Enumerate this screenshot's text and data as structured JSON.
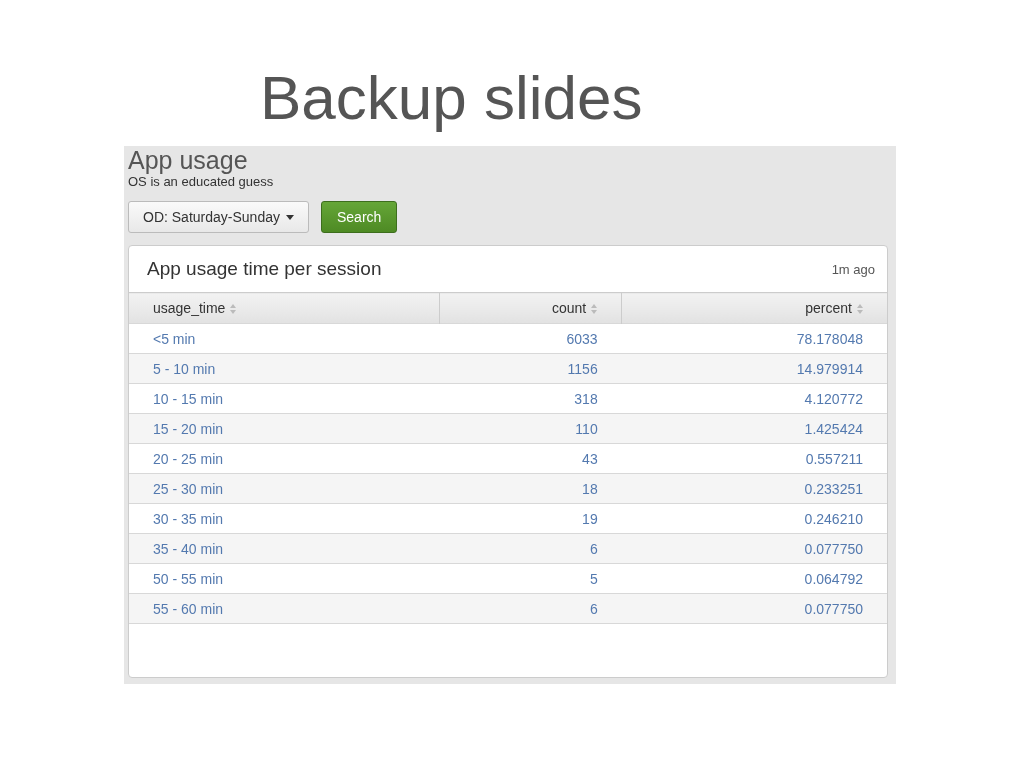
{
  "slide_title": "Backup slides",
  "dashboard": {
    "title": "App usage",
    "description": "OS is an educated guess",
    "dropdown": {
      "value": "OD: Saturday-Sunday"
    },
    "search_button": "Search",
    "panel": {
      "title": "App usage time per session",
      "updated": "1m ago",
      "table": {
        "columns": [
          {
            "label": "usage_time",
            "kind": "text"
          },
          {
            "label": "count",
            "kind": "number"
          },
          {
            "label": "percent",
            "kind": "number"
          }
        ],
        "rows": [
          [
            "<5 min",
            "6033",
            "78.178048"
          ],
          [
            "5 - 10 min",
            "1156",
            "14.979914"
          ],
          [
            "10 - 15 min",
            "318",
            "4.120772"
          ],
          [
            "15 - 20 min",
            "110",
            "1.425424"
          ],
          [
            "20 - 25 min",
            "43",
            "0.557211"
          ],
          [
            "25 - 30 min",
            "18",
            "0.233251"
          ],
          [
            "30 - 35 min",
            "19",
            "0.246210"
          ],
          [
            "35 - 40 min",
            "6",
            "0.077750"
          ],
          [
            "50 - 55 min",
            "5",
            "0.064792"
          ],
          [
            "55 - 60 min",
            "6",
            "0.077750"
          ]
        ]
      }
    }
  }
}
